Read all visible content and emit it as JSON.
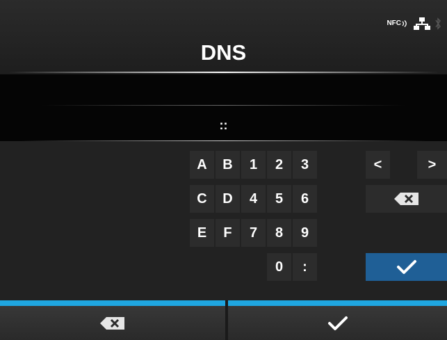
{
  "header": {
    "title": "DNS",
    "status": {
      "nfc_label": "NFC",
      "icons": [
        "nfc-icon",
        "network-icon",
        "bluetooth-icon"
      ]
    }
  },
  "input": {
    "value": "::"
  },
  "keypad": {
    "rows": [
      [
        "A",
        "B",
        "1",
        "2",
        "3"
      ],
      [
        "C",
        "D",
        "4",
        "5",
        "6"
      ],
      [
        "E",
        "F",
        "7",
        "8",
        "9"
      ],
      [
        "",
        "",
        "",
        "0",
        ":"
      ]
    ],
    "nav": {
      "left": "<",
      "right": ">"
    },
    "icons": {
      "backspace": "backspace-icon",
      "confirm": "checkmark-icon"
    }
  },
  "bottom_bar": {
    "left": "backspace-icon",
    "right": "checkmark-icon"
  },
  "colors": {
    "accent": "#1fa6e0",
    "ok_key": "#1f5f96",
    "background": "#1c1c1c"
  }
}
